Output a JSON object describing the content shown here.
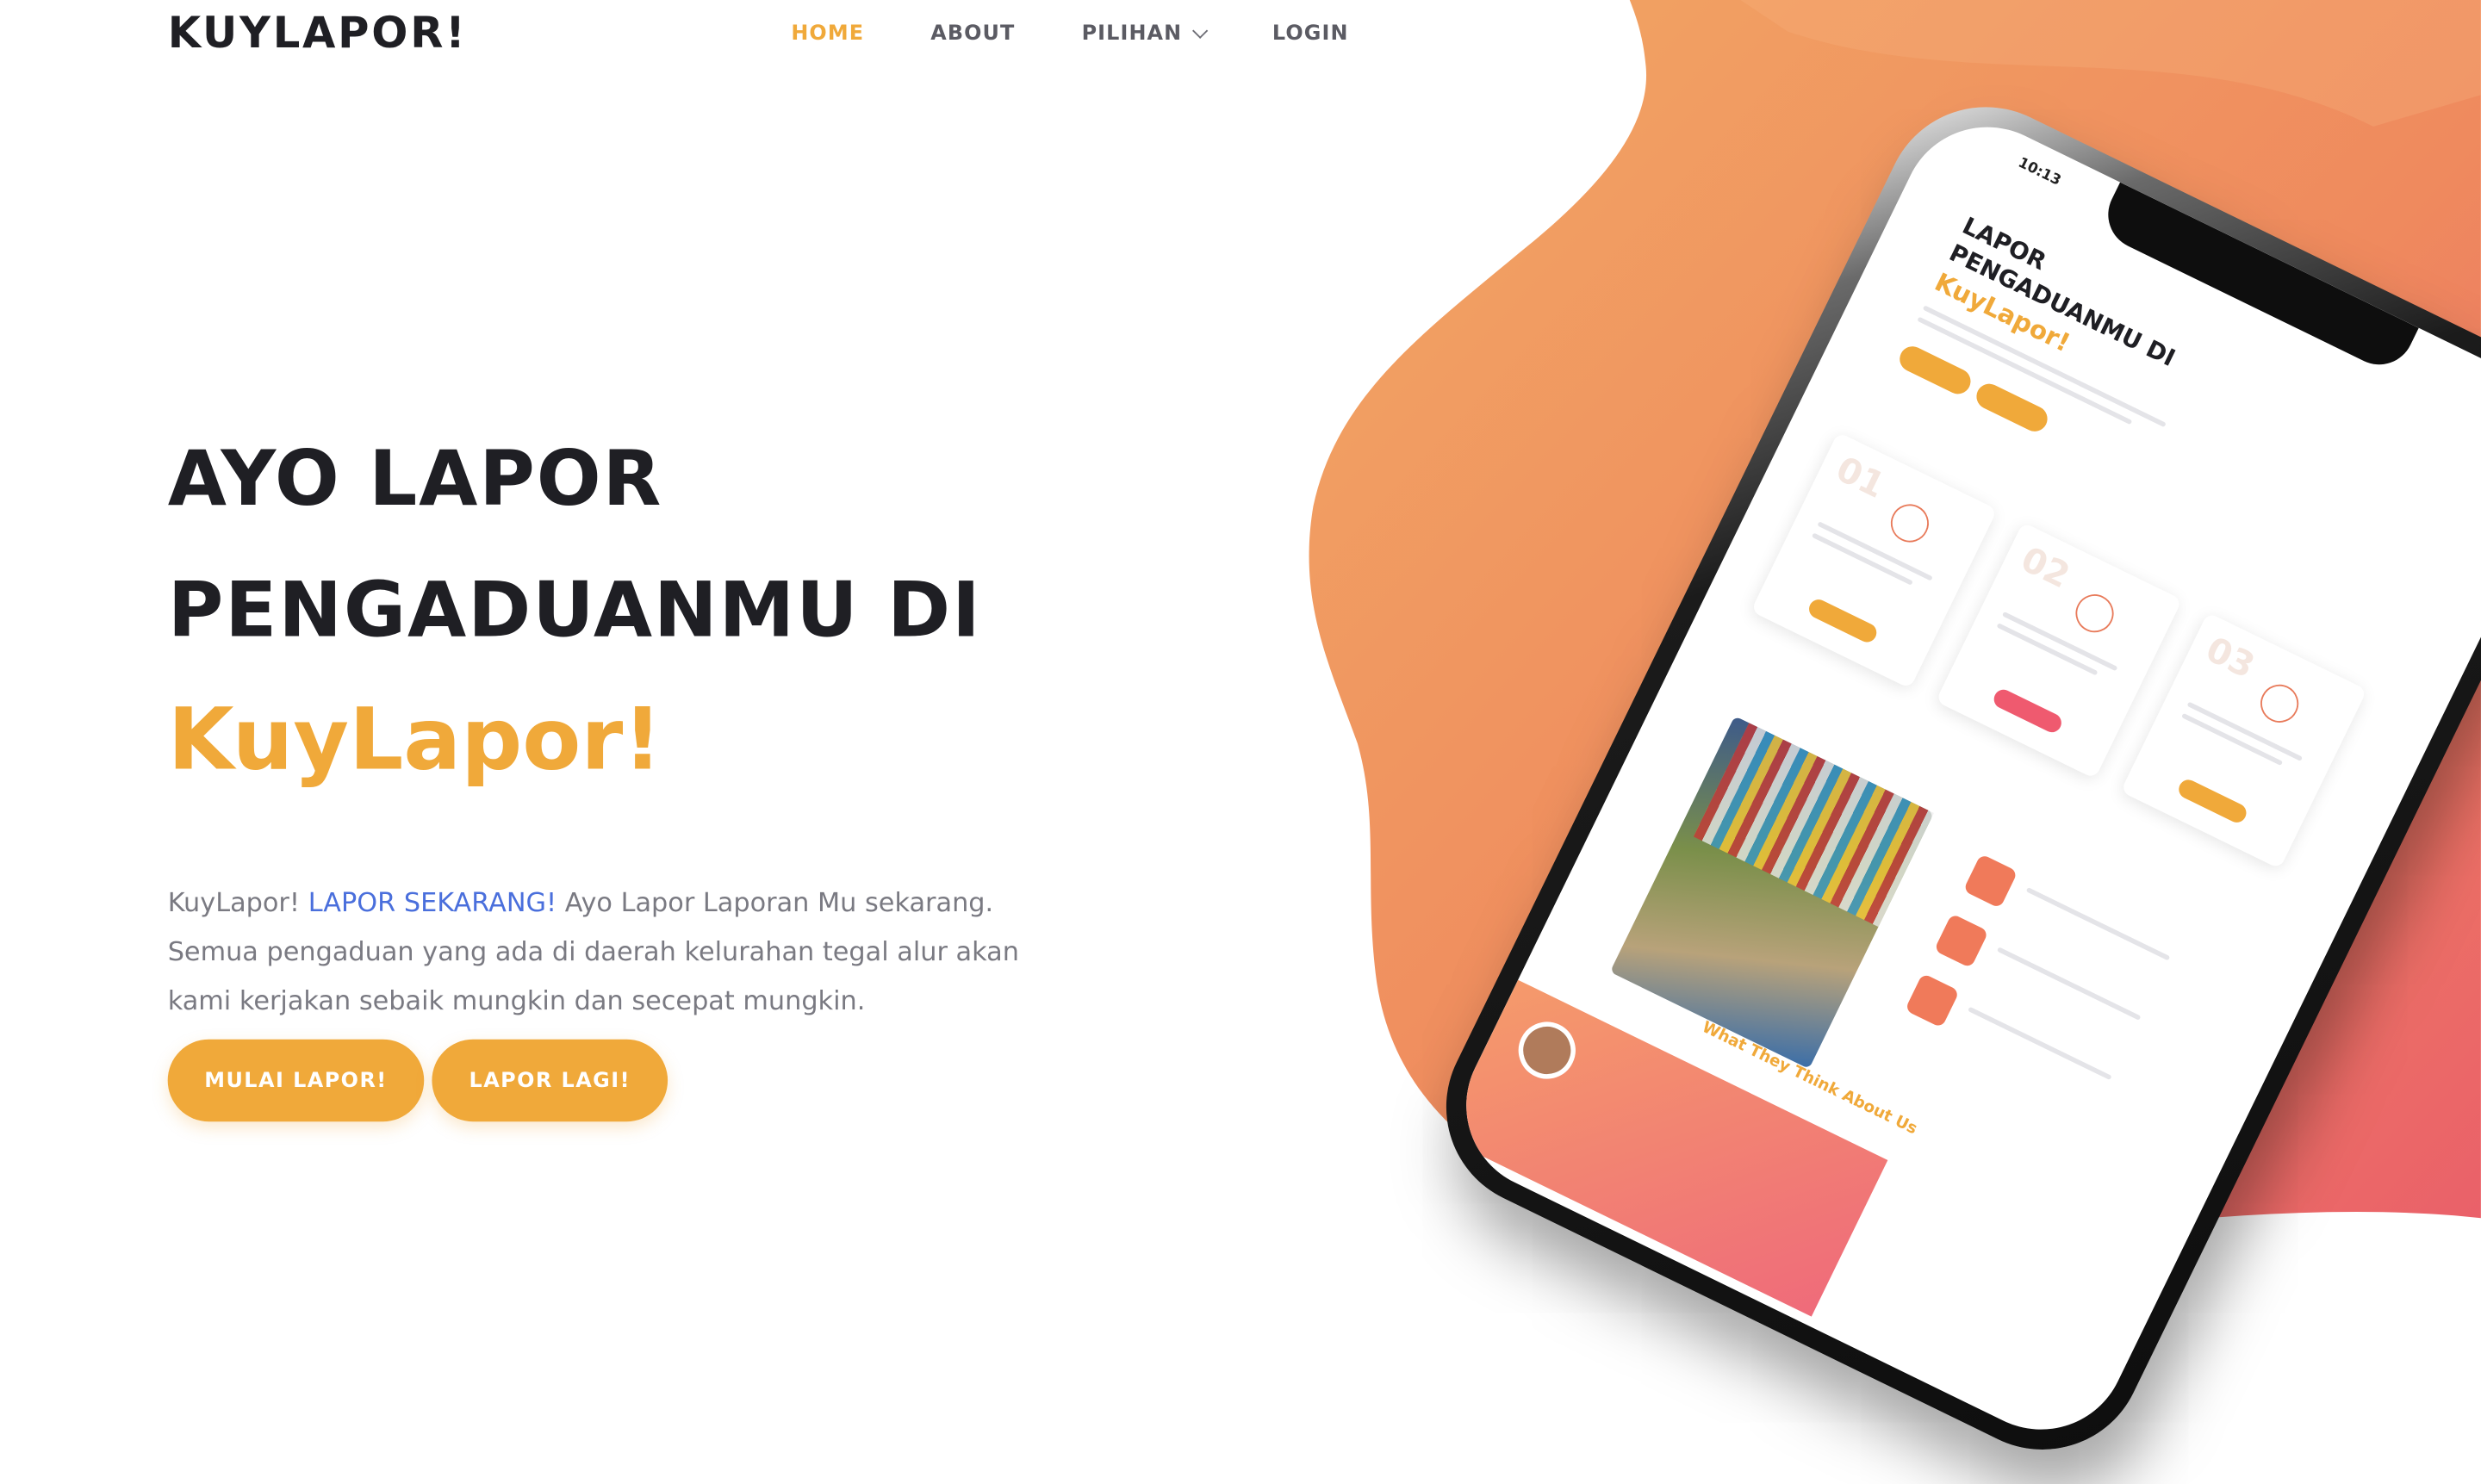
{
  "header": {
    "logo": "KUYLAPOR!",
    "nav": [
      {
        "label": "HOME",
        "active": true
      },
      {
        "label": "ABOUT",
        "active": false
      },
      {
        "label": "PILIHAN",
        "active": false,
        "dropdown": true
      },
      {
        "label": "LOGIN",
        "active": false
      }
    ]
  },
  "hero": {
    "line1": "AYO LAPOR",
    "line2": "PENGADUANMU DI",
    "line3": "KuyLapor!",
    "description_prefix": "KuyLapor! ",
    "description_link": "LAPOR SEKARANG!",
    "description_rest": " Ayo Lapor Laporan Mu sekarang. Semua pengaduan yang ada di daerah kelurahan tegal alur akan kami kerjakan sebaik mungkin dan secepat mungkin.",
    "button_primary": "MULAI LAPOR!",
    "button_secondary": "LAPOR LAGI!"
  },
  "phone": {
    "time": "10:13",
    "title1": "LAPOR",
    "title2": "PENGADUANMU DI",
    "title3": "KuyLapor!",
    "cards": [
      {
        "num": "01"
      },
      {
        "num": "02"
      },
      {
        "num": "03"
      }
    ],
    "testimonial_heading": "What They Think",
    "testimonial_accent": "About Us"
  },
  "colors": {
    "accent": "#f0a93a",
    "link": "#4a6fdc",
    "heading": "#1f1f24",
    "blob_start": "#f0a060",
    "blob_end": "#ec5d6e"
  }
}
